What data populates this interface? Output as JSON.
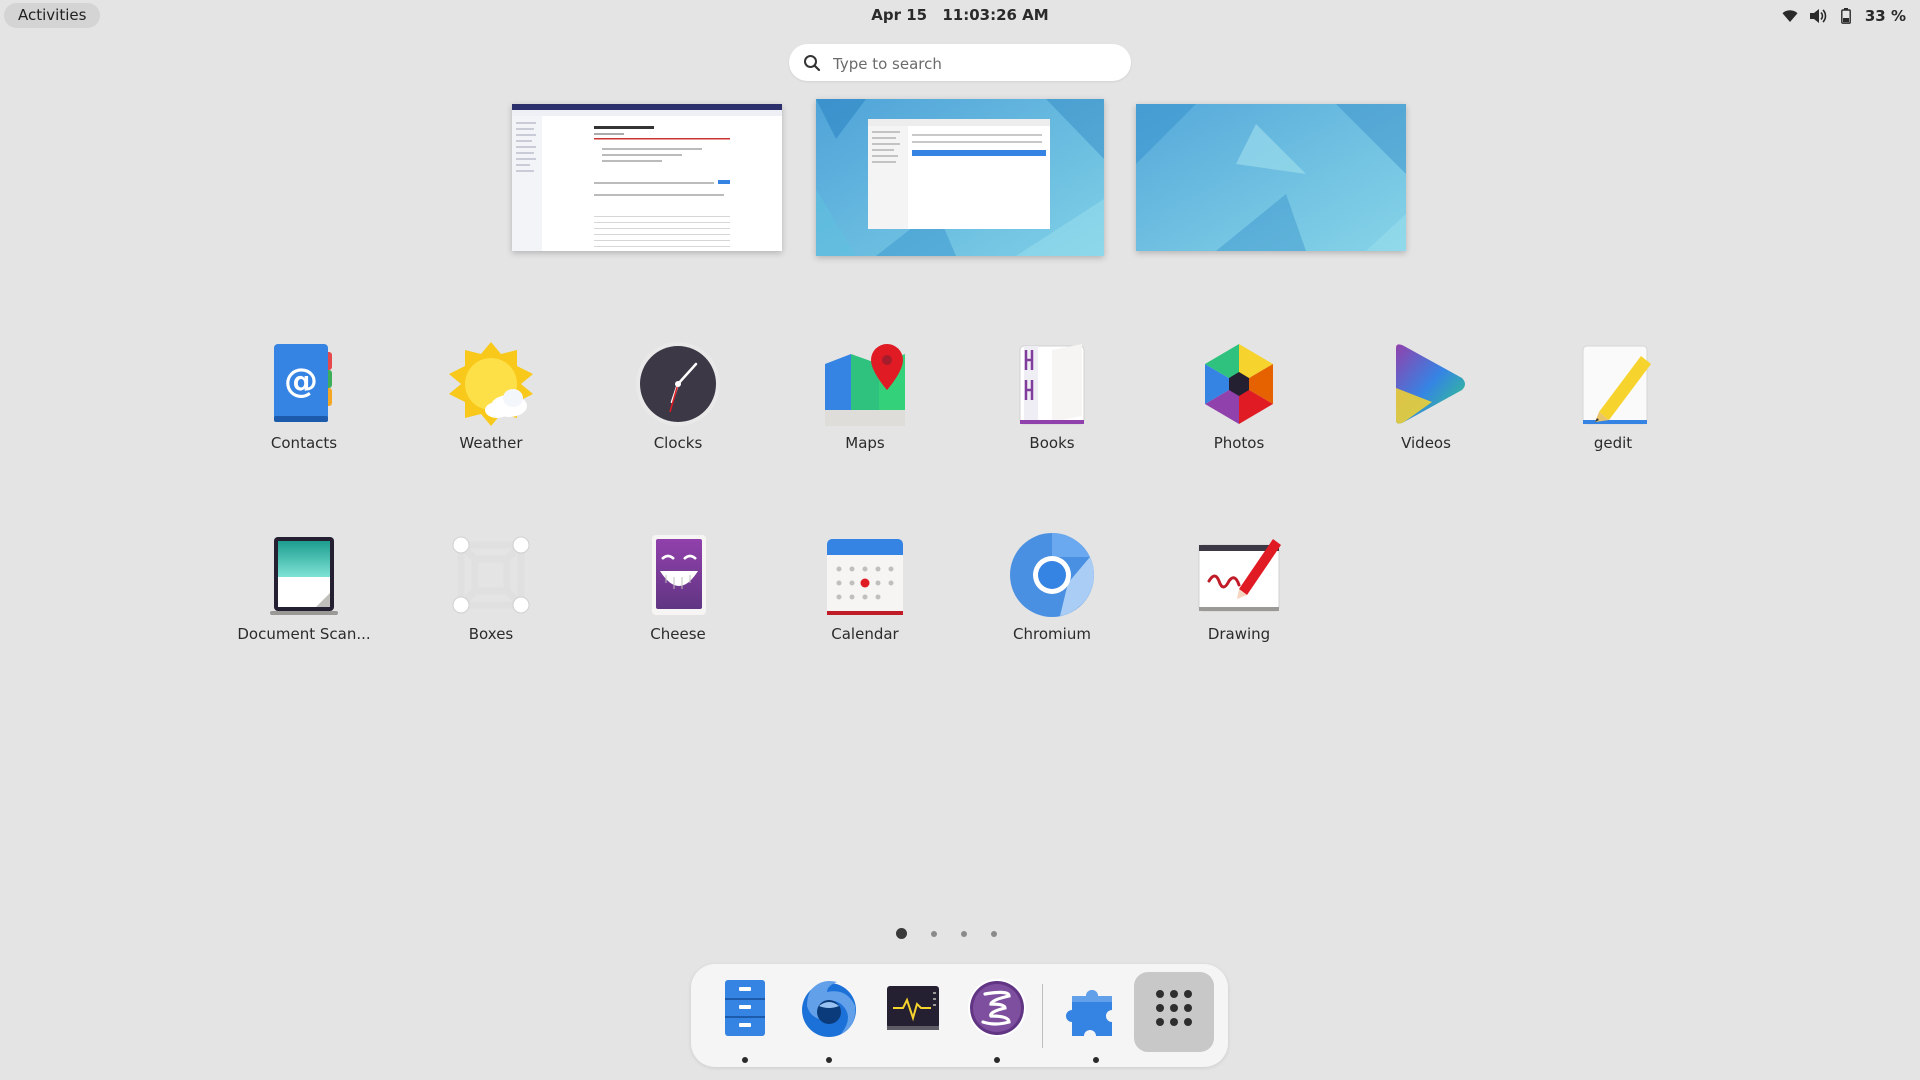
{
  "topbar": {
    "activities": "Activities",
    "date": "Apr 15",
    "time": "11:03:26 AM",
    "battery_percent": "33 %",
    "status_icons": [
      "network-wireless-icon",
      "volume-icon",
      "battery-icon"
    ]
  },
  "search": {
    "placeholder": "Type to search",
    "value": ""
  },
  "workspaces": [
    {
      "index": 1,
      "active": false
    },
    {
      "index": 2,
      "active": true
    },
    {
      "index": 3,
      "active": false
    }
  ],
  "apps": [
    {
      "name": "Contacts",
      "icon": "contacts-icon"
    },
    {
      "name": "Weather",
      "icon": "weather-icon"
    },
    {
      "name": "Clocks",
      "icon": "clocks-icon"
    },
    {
      "name": "Maps",
      "icon": "maps-icon"
    },
    {
      "name": "Books",
      "icon": "books-icon"
    },
    {
      "name": "Photos",
      "icon": "photos-icon"
    },
    {
      "name": "Videos",
      "icon": "videos-icon"
    },
    {
      "name": "gedit",
      "icon": "gedit-icon"
    },
    {
      "name": "Document Scan...",
      "icon": "document-scanner-icon"
    },
    {
      "name": "Boxes",
      "icon": "boxes-icon"
    },
    {
      "name": "Cheese",
      "icon": "cheese-icon"
    },
    {
      "name": "Calendar",
      "icon": "calendar-icon"
    },
    {
      "name": "Chromium",
      "icon": "chromium-icon"
    },
    {
      "name": "Drawing",
      "icon": "drawing-icon"
    }
  ],
  "pagination": {
    "pages": 4,
    "current": 1
  },
  "dash": [
    {
      "icon": "files-icon",
      "running": true
    },
    {
      "icon": "firefox-icon",
      "running": true
    },
    {
      "icon": "system-monitor-icon",
      "running": false
    },
    {
      "icon": "emacs-icon",
      "running": true
    },
    {
      "icon": "extensions-icon",
      "running": true
    },
    {
      "icon": "show-apps-icon",
      "running": false
    }
  ],
  "colors": {
    "background": "#e4e4e4",
    "accent": "#3584e4"
  }
}
